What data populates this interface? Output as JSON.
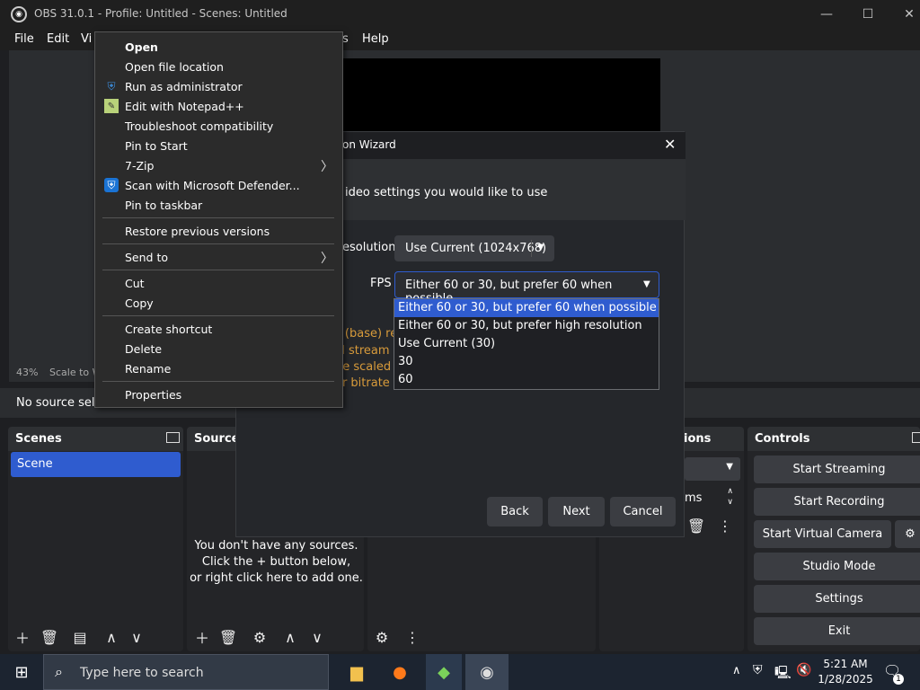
{
  "window": {
    "title": "OBS 31.0.1 - Profile: Untitled - Scenes: Untitled",
    "minimize": "—",
    "maximize": "☐",
    "close": "✕"
  },
  "menubar": [
    "File",
    "Edit",
    "Vi",
    "s",
    "Help"
  ],
  "preview": {
    "zoom_pct": "43%",
    "scale_label": "Scale to W",
    "no_source": "No source sele"
  },
  "scenes": {
    "title": "Scenes",
    "items": [
      "Scene"
    ]
  },
  "sources": {
    "title": "Source",
    "empty_text": [
      "You don't have any sources.",
      "Click the + button below,",
      "or right click here to add one."
    ]
  },
  "transitions": {
    "title": "ions",
    "duration_suffix": "ms"
  },
  "controls": {
    "title": "Controls",
    "buttons": [
      "Start Streaming",
      "Start Recording",
      "Start Virtual Camera",
      "Studio Mode",
      "Settings",
      "Exit"
    ]
  },
  "wizard": {
    "title": "on Wizard",
    "banner": "ideo settings you would like to use",
    "resolution_label": "esolution",
    "resolution_value": "Use Current (1024x768)",
    "fps_label": "FPS",
    "fps_value": "Either 60 or 30, but prefer 60 when possible",
    "orange_lines": [
      "s (base) re",
      "ill stream",
      "he scaled o",
      "or bitrate i"
    ],
    "fps_options": [
      "Either 60 or 30, but prefer 60 when possible",
      "Either 60 or 30, but prefer high resolution",
      "Use Current (30)",
      "30",
      "60"
    ],
    "back": "Back",
    "next": "Next",
    "cancel": "Cancel"
  },
  "context_menu": {
    "items": [
      {
        "label": "Open",
        "bold": true
      },
      {
        "label": "Open file location"
      },
      {
        "label": "Run as administrator",
        "icon": "shield-uac-icon"
      },
      {
        "label": "Edit with Notepad++",
        "icon": "notepad-plus-icon"
      },
      {
        "label": "Troubleshoot compatibility"
      },
      {
        "label": "Pin to Start"
      },
      {
        "label": "7-Zip",
        "submenu": true
      },
      {
        "label": "Scan with Microsoft Defender...",
        "icon": "defender-shield-icon"
      },
      {
        "label": "Pin to taskbar"
      },
      {
        "label": "Restore previous versions"
      },
      {
        "label": "Send to",
        "submenu": true
      },
      {
        "label": "Cut"
      },
      {
        "label": "Copy"
      },
      {
        "label": "Create shortcut"
      },
      {
        "label": "Delete"
      },
      {
        "label": "Rename"
      },
      {
        "label": "Properties"
      }
    ]
  },
  "taskbar": {
    "search_placeholder": "Type here to search",
    "time": "5:21 AM",
    "date": "1/28/2025",
    "notification_count": "1"
  },
  "colors": {
    "accent": "#2f5ccf",
    "warning_text": "#d89b3b"
  }
}
